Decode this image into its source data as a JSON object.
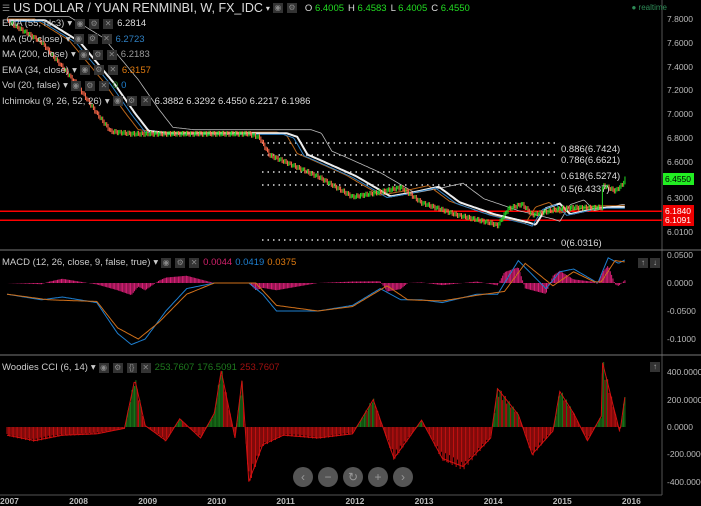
{
  "header": {
    "title": "US DOLLAR / YUAN RENMINBI, W, FX_IDC",
    "ohlc": [
      {
        "k": "O",
        "v": "6.4005"
      },
      {
        "k": "H",
        "v": "6.4583"
      },
      {
        "k": "L",
        "v": "6.4005"
      },
      {
        "k": "C",
        "v": "6.4550"
      }
    ],
    "realtime": "realtime"
  },
  "indicators": [
    {
      "label": "EMA (55, hlc3)",
      "values": [
        {
          "v": "6.2814",
          "c": "#dddddd"
        }
      ]
    },
    {
      "label": "MA (50, close)",
      "values": [
        {
          "v": "6.2723",
          "c": "#2f7fc1"
        }
      ]
    },
    {
      "label": "MA (200, close)",
      "values": [
        {
          "v": "6.2183",
          "c": "#999999"
        }
      ]
    },
    {
      "label": "EMA (34, close)",
      "values": [
        {
          "v": "6.3157",
          "c": "#e07b10"
        }
      ]
    },
    {
      "label": "Vol (20, false)",
      "values": [
        {
          "v": "0",
          "c": "#2e8b2e"
        },
        {
          "v": "0",
          "c": "#1e7fd0"
        }
      ]
    },
    {
      "label": "Ichimoku (9, 26, 52, 26)",
      "values": [
        {
          "v": "6.3882 6.3292 6.4550 6.2217 6.1986",
          "c": "#dddddd"
        }
      ]
    }
  ],
  "macd": {
    "label": "MACD (12, 26, close, 9, false, true)",
    "values": [
      {
        "v": "0.0044",
        "c": "#d0206a"
      },
      {
        "v": "0.0419",
        "c": "#1e7fd0"
      },
      {
        "v": "0.0375",
        "c": "#e07b10"
      }
    ]
  },
  "cci": {
    "label": "Woodies CCI (6, 14)",
    "values": [
      {
        "v": "253.7607",
        "c": "#1e7a1e"
      },
      {
        "v": "176.5091",
        "c": "#1e7a1e"
      },
      {
        "v": "253.7607",
        "c": "#a01010"
      }
    ]
  },
  "colors": {
    "up": "#22dd22",
    "down": "#ff6a4a",
    "bg": "#000000",
    "hline": "#ff0000",
    "last": "#22ee22"
  },
  "chart_data": [
    {
      "type": "line",
      "title": "US DOLLAR / YUAN RENMINBI, W, FX_IDC",
      "x_ticks": [
        "2007",
        "2008",
        "2009",
        "2010",
        "2011",
        "2012",
        "2013",
        "2014",
        "2015",
        "2016"
      ],
      "y_ticks": [
        "7.8000",
        "7.6000",
        "7.4000",
        "7.2000",
        "7.0000",
        "6.8000",
        "6.6000",
        "6.3000",
        "6.0100"
      ],
      "ylim": [
        6.0,
        7.95
      ],
      "price": [
        [
          2007.0,
          7.78
        ],
        [
          2007.5,
          7.6
        ],
        [
          2008.0,
          7.25
        ],
        [
          2008.3,
          7.0
        ],
        [
          2008.5,
          6.85
        ],
        [
          2008.8,
          6.83
        ],
        [
          2010.5,
          6.83
        ],
        [
          2010.65,
          6.8
        ],
        [
          2010.8,
          6.65
        ],
        [
          2011.0,
          6.6
        ],
        [
          2011.5,
          6.47
        ],
        [
          2012.0,
          6.3
        ],
        [
          2012.3,
          6.33
        ],
        [
          2012.7,
          6.38
        ],
        [
          2013.0,
          6.25
        ],
        [
          2013.5,
          6.15
        ],
        [
          2014.0,
          6.08
        ],
        [
          2014.1,
          6.06
        ],
        [
          2014.25,
          6.2
        ],
        [
          2014.45,
          6.24
        ],
        [
          2014.6,
          6.15
        ],
        [
          2015.0,
          6.2
        ],
        [
          2015.2,
          6.21
        ],
        [
          2015.6,
          6.21
        ],
        [
          2015.62,
          6.4
        ],
        [
          2015.8,
          6.35
        ],
        [
          2015.9,
          6.4
        ],
        [
          2015.95,
          6.455
        ]
      ],
      "hlines": [
        {
          "label": "6.1840",
          "value": 6.184
        },
        {
          "label": "6.1091",
          "value": 6.1091
        }
      ],
      "last_price": "6.4550",
      "fib": [
        {
          "label": "0.886(6.7424)",
          "value": 6.7424
        },
        {
          "label": "0.786(6.6621)",
          "value": 6.6621
        },
        {
          "label": "0.618(6.5274)",
          "value": 6.5274
        },
        {
          "label": "0.5(6.4337)",
          "value": 6.4337
        },
        {
          "label": "0(6.0316)",
          "value": 6.0316
        }
      ]
    },
    {
      "type": "line",
      "title": "MACD (12, 26, close, 9, false, true)",
      "y_ticks": [
        "0.0500",
        "0.0000",
        "-0.0500",
        "-0.1000"
      ],
      "ylim": [
        -0.12,
        0.06
      ],
      "macd": [
        [
          2007,
          -0.02
        ],
        [
          2007.5,
          -0.03
        ],
        [
          2007.8,
          -0.025
        ],
        [
          2008.3,
          -0.035
        ],
        [
          2008.6,
          -0.09
        ],
        [
          2008.8,
          -0.11
        ],
        [
          2009.0,
          -0.1
        ],
        [
          2009.3,
          -0.05
        ],
        [
          2009.6,
          -0.01
        ],
        [
          2010,
          0
        ],
        [
          2010.5,
          0
        ],
        [
          2010.7,
          -0.02
        ],
        [
          2010.9,
          -0.05
        ],
        [
          2011.5,
          -0.05
        ],
        [
          2012,
          -0.04
        ],
        [
          2012.4,
          -0.01
        ],
        [
          2012.7,
          -0.03
        ],
        [
          2013,
          -0.03
        ],
        [
          2013.3,
          -0.035
        ],
        [
          2013.8,
          -0.02
        ],
        [
          2014.1,
          -0.02
        ],
        [
          2014.4,
          0.04
        ],
        [
          2014.8,
          -0.01
        ],
        [
          2015.0,
          0.02
        ],
        [
          2015.2,
          0.025
        ],
        [
          2015.55,
          0
        ],
        [
          2015.7,
          0.045
        ],
        [
          2015.85,
          0.035
        ],
        [
          2015.95,
          0.0419
        ]
      ],
      "signal": [
        [
          2007,
          -0.02
        ],
        [
          2007.6,
          -0.03
        ],
        [
          2008.3,
          -0.033
        ],
        [
          2008.6,
          -0.08
        ],
        [
          2008.9,
          -0.1
        ],
        [
          2009.2,
          -0.07
        ],
        [
          2009.6,
          -0.02
        ],
        [
          2010,
          0
        ],
        [
          2010.6,
          0
        ],
        [
          2010.9,
          -0.04
        ],
        [
          2011.5,
          -0.05
        ],
        [
          2012,
          -0.042
        ],
        [
          2012.5,
          -0.005
        ],
        [
          2012.8,
          -0.03
        ],
        [
          2013.3,
          -0.032
        ],
        [
          2013.8,
          -0.022
        ],
        [
          2014.2,
          -0.015
        ],
        [
          2014.5,
          0.035
        ],
        [
          2014.9,
          -0.005
        ],
        [
          2015.2,
          0.02
        ],
        [
          2015.5,
          0.002
        ],
        [
          2015.6,
          0.002
        ],
        [
          2015.8,
          0.04
        ],
        [
          2015.95,
          0.0375
        ]
      ]
    },
    {
      "type": "bar",
      "title": "Woodies CCI (6, 14)",
      "y_ticks": [
        "400.0000",
        "200.0000",
        "0.0000",
        "-200.0000",
        "-400.0000"
      ],
      "ylim": [
        -480,
        500
      ],
      "cci": [
        [
          2007,
          -60
        ],
        [
          2007.4,
          -100
        ],
        [
          2007.8,
          -60
        ],
        [
          2008.3,
          -50
        ],
        [
          2008.7,
          -10
        ],
        [
          2008.85,
          350
        ],
        [
          2009,
          10
        ],
        [
          2009.3,
          -100
        ],
        [
          2009.5,
          60
        ],
        [
          2009.8,
          -80
        ],
        [
          2010.0,
          100
        ],
        [
          2010.1,
          410
        ],
        [
          2010.3,
          -80
        ],
        [
          2010.4,
          340
        ],
        [
          2010.5,
          -400
        ],
        [
          2010.7,
          -130
        ],
        [
          2011,
          -60
        ],
        [
          2011.5,
          -80
        ],
        [
          2012,
          -50
        ],
        [
          2012.3,
          200
        ],
        [
          2012.6,
          -230
        ],
        [
          2013,
          50
        ],
        [
          2013.3,
          -230
        ],
        [
          2013.6,
          -290
        ],
        [
          2014,
          -80
        ],
        [
          2014.1,
          280
        ],
        [
          2014.4,
          90
        ],
        [
          2014.6,
          -200
        ],
        [
          2014.9,
          -30
        ],
        [
          2015,
          260
        ],
        [
          2015.2,
          100
        ],
        [
          2015.4,
          -100
        ],
        [
          2015.6,
          80
        ],
        [
          2015.62,
          470
        ],
        [
          2015.8,
          100
        ],
        [
          2015.87,
          -40
        ],
        [
          2015.95,
          253.7607
        ]
      ]
    }
  ]
}
